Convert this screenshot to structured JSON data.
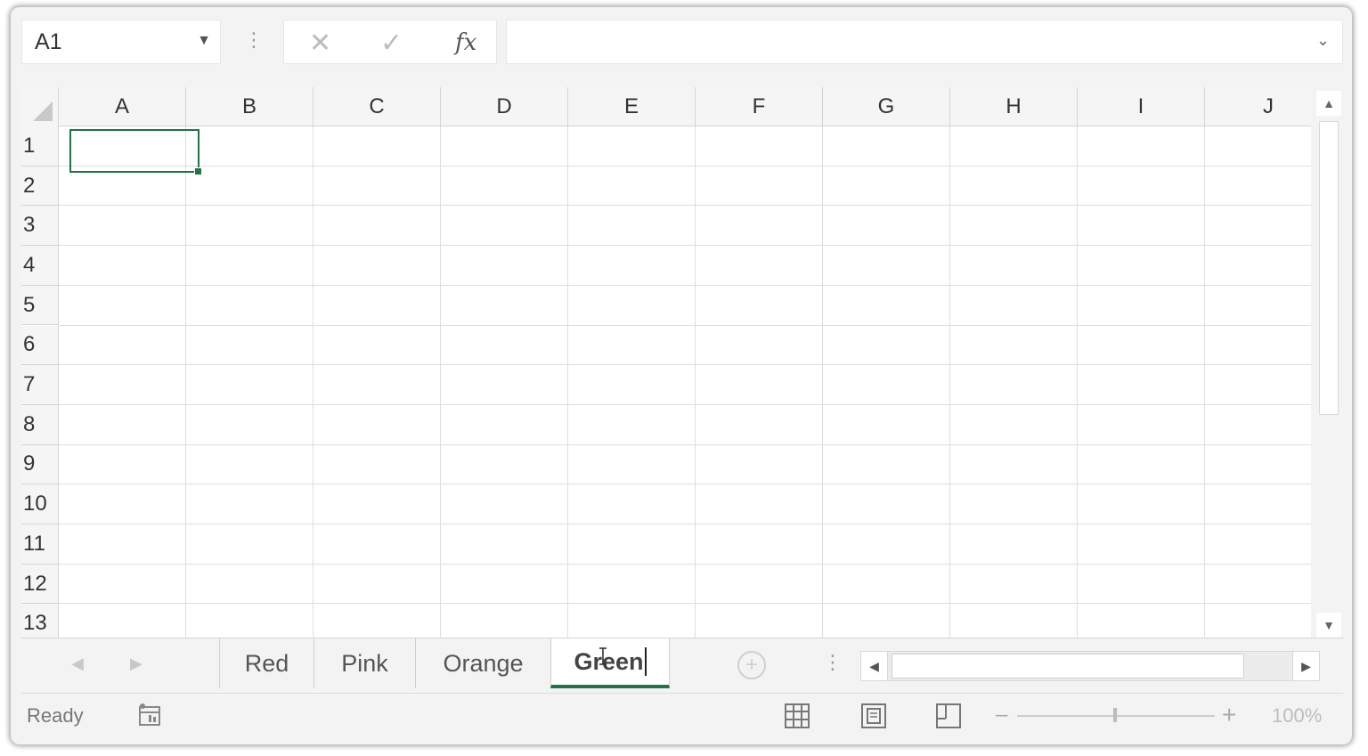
{
  "formula_bar": {
    "name_box": "A1",
    "cancel_icon": "x-icon",
    "enter_icon": "check-icon",
    "function_label": "fx",
    "formula_value": ""
  },
  "grid": {
    "columns": [
      "A",
      "B",
      "C",
      "D",
      "E",
      "F",
      "G",
      "H",
      "I",
      "J"
    ],
    "rows": [
      "1",
      "2",
      "3",
      "4",
      "5",
      "6",
      "7",
      "8",
      "9",
      "10",
      "11",
      "12",
      "13"
    ],
    "selected_cell": "A1",
    "accent_color": "#217346"
  },
  "sheets": {
    "tabs": [
      {
        "label": "Red",
        "active": false
      },
      {
        "label": "Pink",
        "active": false
      },
      {
        "label": "Orange",
        "active": false
      },
      {
        "label": "Green",
        "active": true,
        "editing": true
      }
    ]
  },
  "status": {
    "mode": "Ready",
    "zoom_level": "100%"
  }
}
